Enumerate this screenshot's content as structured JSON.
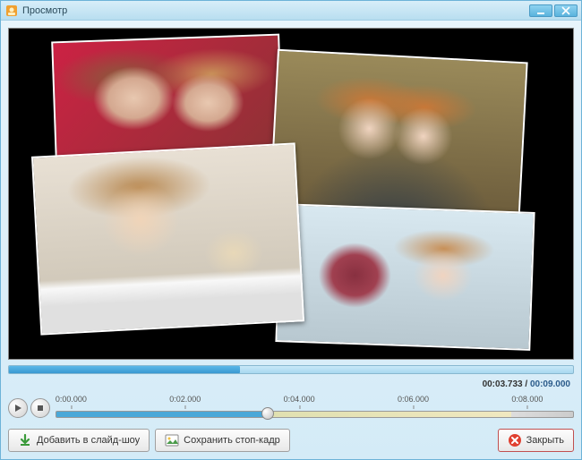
{
  "window": {
    "title": "Просмотр"
  },
  "time": {
    "current": "00:03.733",
    "separator": " / ",
    "total": "00:09.000"
  },
  "timeline": {
    "ticks": [
      "0:00.000",
      "0:02.000",
      "0:04.000",
      "0:06.000",
      "0:08.000"
    ],
    "progress_percent": 41
  },
  "buttons": {
    "add_to_slideshow": "Добавить в слайд-шоу",
    "save_frame": "Сохранить стоп-кадр",
    "close": "Закрыть"
  },
  "icons": {
    "app": "app-icon",
    "minimize": "minimize-icon",
    "close_win": "close-icon",
    "play": "play-icon",
    "stop": "stop-icon",
    "arrow_down": "arrow-down-icon",
    "picture": "picture-icon",
    "cancel": "cancel-icon"
  }
}
